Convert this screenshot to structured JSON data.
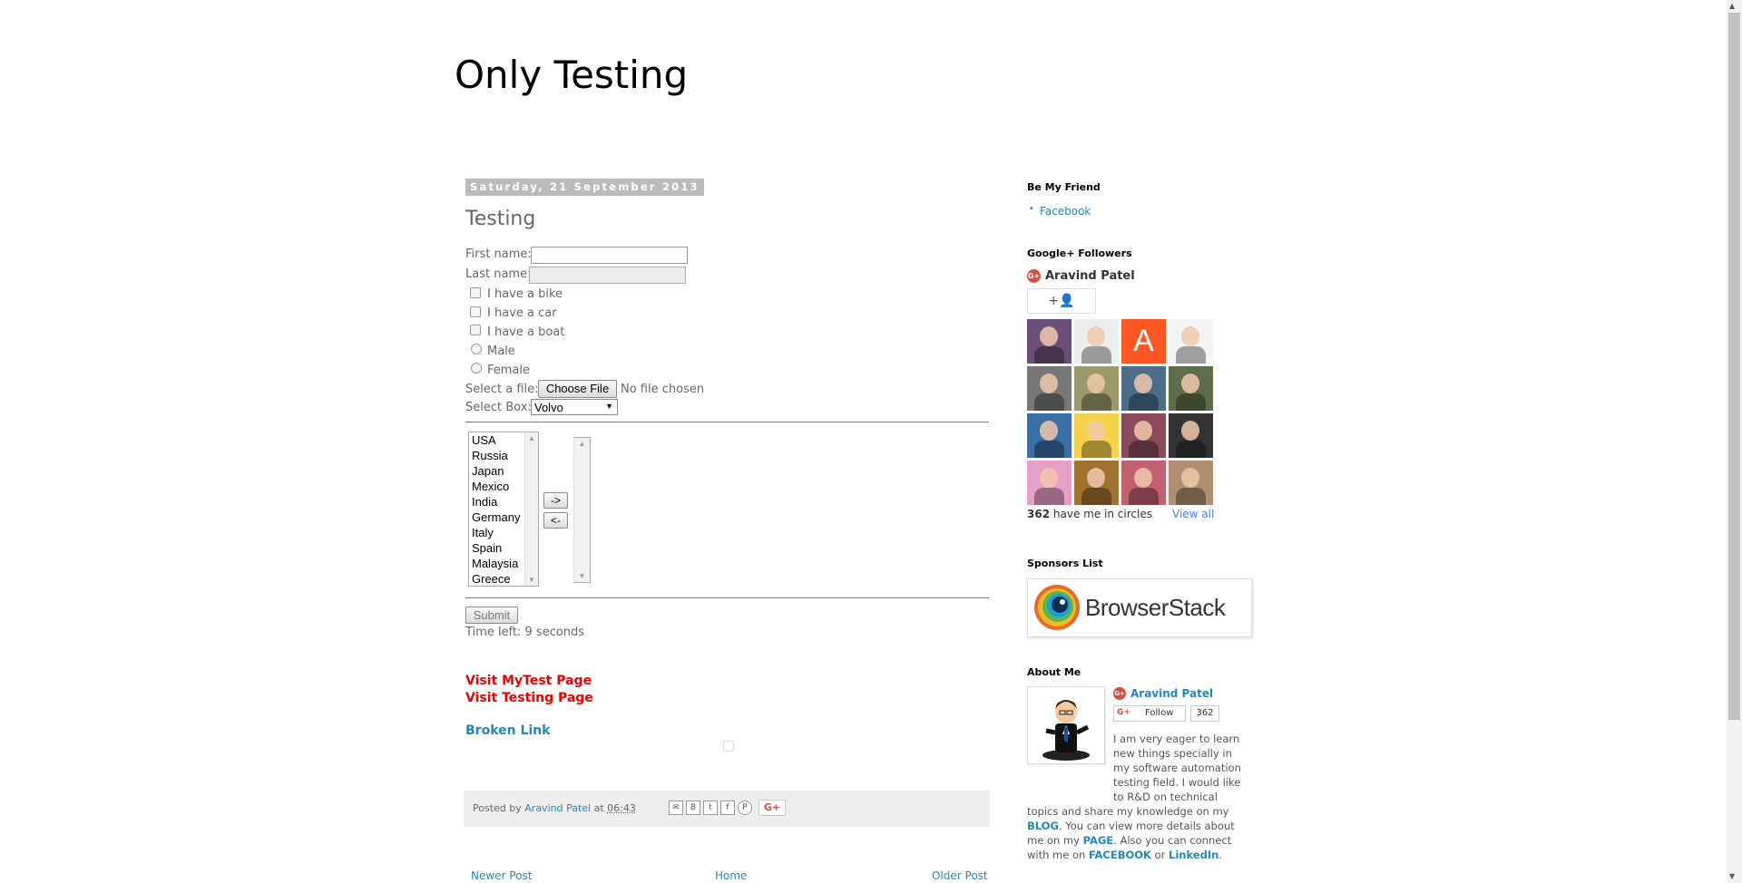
{
  "header": {
    "title": "Only Testing"
  },
  "post": {
    "date": "Saturday, 21 September 2013",
    "title": "Testing",
    "form": {
      "first_name_label": "First name:",
      "last_name_label": "Last name:",
      "checkboxes": [
        "I have a bike",
        "I have a car",
        "I have a boat"
      ],
      "radios": [
        "Male",
        "Female"
      ],
      "file_label": "Select a file:",
      "file_button": "Choose File",
      "file_status": "No file chosen",
      "select_label": "Select Box:",
      "select_value": "Volvo",
      "countries": [
        "USA",
        "Russia",
        "Japan",
        "Mexico",
        "India",
        "Germany",
        "Italy",
        "Spain",
        "Malaysia",
        "Greece"
      ],
      "move_right": "->",
      "move_left": "<-",
      "submit": "Submit",
      "time_left": "Time left: 9 seconds"
    },
    "links": {
      "mytest": "Visit MyTest Page",
      "testing": "Visit Testing Page",
      "broken": "Broken Link"
    },
    "footer": {
      "posted_by": "Posted by",
      "author": "Aravind Patel",
      "at": "at",
      "time": "06:43",
      "share_icons": [
        "email-icon",
        "blogger-icon",
        "twitter-icon",
        "facebook-icon",
        "pinterest-icon"
      ],
      "gplus": "G+"
    }
  },
  "nav": {
    "newer": "Newer Post",
    "home": "Home",
    "older": "Older Post"
  },
  "sidebar": {
    "friend": {
      "heading": "Be My Friend",
      "link": "Facebook"
    },
    "followers": {
      "heading": "Google+ Followers",
      "name": "Aravind Patel",
      "count": "362",
      "circles_text": "have me in circles",
      "view_all": "View all"
    },
    "sponsors": {
      "heading": "Sponsors List",
      "brand": "BrowserStack"
    },
    "about": {
      "heading": "About Me",
      "name": "Aravind Patel",
      "follow": "Follow",
      "follow_count": "362",
      "text1": "I am very eager to learn new things specially in my software automation testing field. I would like to R&D on technical topics and share my knowledge on my ",
      "blog": "BLOG",
      "text2": ". You can view more details about me on my ",
      "page": "PAGE",
      "text3": ". Also you can connect with me on ",
      "facebook": "FACEBOOK",
      "or": " or ",
      "linkedin": "LinkedIn",
      "end": "."
    }
  },
  "colors": {
    "link": "#2288bb",
    "red_link": "#ee0000",
    "date_bg": "#bbbbbb"
  }
}
